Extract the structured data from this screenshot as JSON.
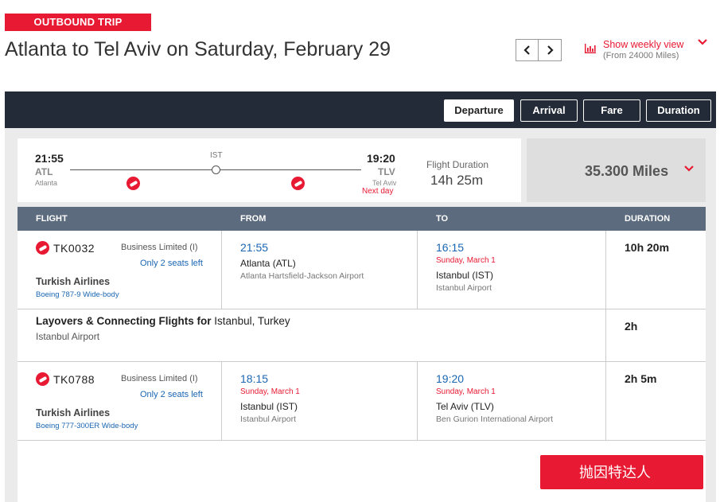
{
  "header": {
    "badge": "OUTBOUND TRIP",
    "title": "Atlanta to Tel Aviv on Saturday, February 29",
    "prev_icon": "chevron-left-icon",
    "next_icon": "chevron-right-icon",
    "weekly_label": "Show weekly view",
    "weekly_sub": "(From 24000 Miles)"
  },
  "sort": {
    "departure": "Departure",
    "arrival": "Arrival",
    "fare": "Fare",
    "duration": "Duration",
    "active": "Departure"
  },
  "summary": {
    "dep_time": "21:55",
    "dep_code": "ATL",
    "dep_city": "Atlanta",
    "stop": "IST",
    "arr_time": "19:20",
    "arr_code": "TLV",
    "arr_city": "Tel Aviv",
    "next_day": "Next day",
    "duration_label": "Flight Duration",
    "duration_value": "14h 25m",
    "miles": "35.300 Miles"
  },
  "table": {
    "headers": [
      "FLIGHT",
      "FROM",
      "TO",
      "DURATION"
    ],
    "segments": [
      {
        "flight": "TK0032",
        "cabin": "Business Limited (I)",
        "seats": "Only 2 seats left",
        "airline": "Turkish Airlines",
        "aircraft": "Boeing 787-9 Wide-body",
        "from_time": "21:55",
        "from_date": "",
        "from_city": "Atlanta (ATL)",
        "from_airport": "Atlanta Hartsfield-Jackson Airport",
        "to_time": "16:15",
        "to_date": "Sunday, March 1",
        "to_city": "Istanbul (IST)",
        "to_airport": "Istanbul Airport",
        "duration": "10h 20m"
      },
      {
        "flight": "TK0788",
        "cabin": "Business Limited (I)",
        "seats": "Only 2 seats left",
        "airline": "Turkish Airlines",
        "aircraft": "Boeing 777-300ER Wide-body",
        "from_time": "18:15",
        "from_date": "Sunday, March 1",
        "from_city": "Istanbul (IST)",
        "from_airport": "Istanbul Airport",
        "to_time": "19:20",
        "to_date": "Sunday, March 1",
        "to_city": "Tel Aviv (TLV)",
        "to_airport": "Ben Gurion International Airport",
        "duration": "2h 5m"
      }
    ],
    "layover": {
      "title": "Layovers & Connecting Flights for",
      "place": "Istanbul, Turkey",
      "airport": "Istanbul Airport",
      "duration": "2h"
    }
  },
  "watermark": "抛因特达人",
  "colors": {
    "brand_red": "#e81932",
    "header_dark": "#232b38",
    "table_head": "#5c6b7d",
    "link_blue": "#1a66b3"
  }
}
